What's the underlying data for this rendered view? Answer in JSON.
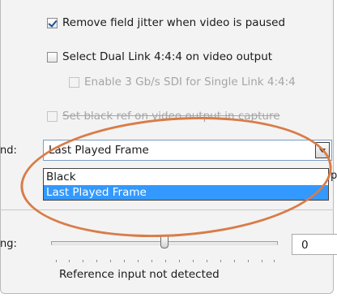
{
  "options": {
    "remove_jitter": {
      "label": "Remove field jitter when video is paused",
      "checked": true,
      "enabled": true
    },
    "dual_link": {
      "label": "Select Dual Link 4:4:4 on video output",
      "checked": false,
      "enabled": true
    },
    "enable_3g": {
      "label": "Enable 3 Gb/s SDI for Single Link 4:4:4",
      "checked": false,
      "enabled": false
    },
    "black_ref": {
      "label": "Set black ref on video output in capture",
      "checked": false,
      "enabled": false
    }
  },
  "background_row": {
    "label_fragment": "nd:",
    "selected": "Last Played Frame",
    "options": [
      "Black",
      "Last Played Frame"
    ],
    "highlighted_index": 1,
    "clipped_text_right": "p"
  },
  "timing_row": {
    "label_fragment": "ng:",
    "slider_fraction": 0.5,
    "value": "0",
    "status": "Reference input not detected"
  },
  "colors": {
    "highlight_ring": "#d97c48",
    "selection": "#3399ff"
  }
}
